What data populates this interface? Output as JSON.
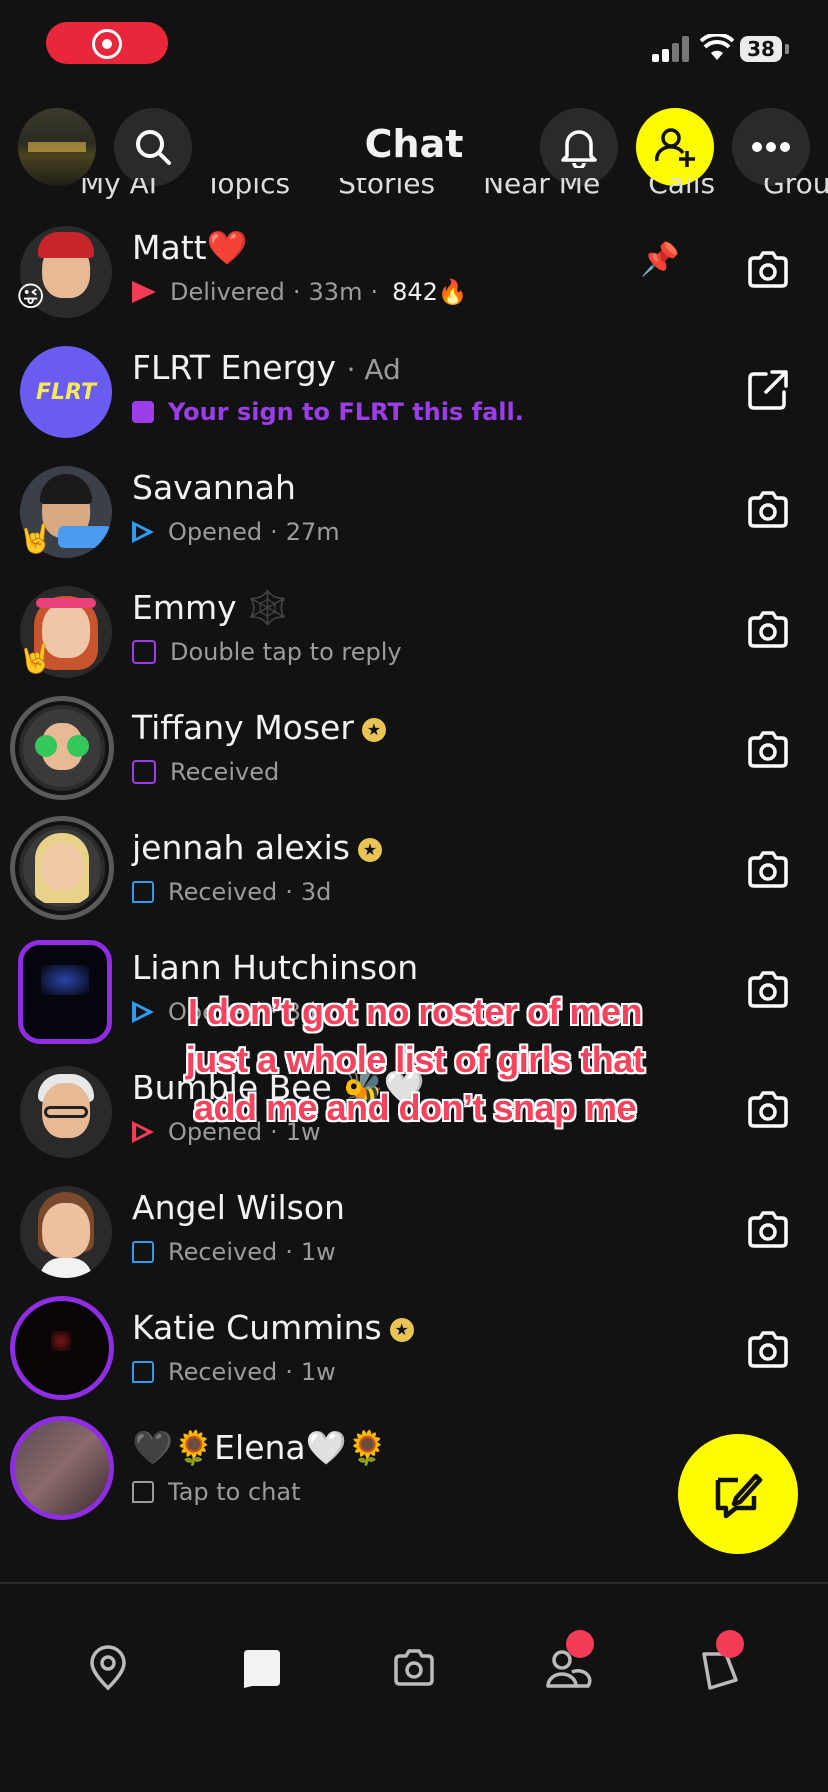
{
  "status_bar": {
    "battery": "38"
  },
  "header": {
    "title": "Chat"
  },
  "tabs": [
    "My AI",
    "Topics",
    "Stories",
    "Near Me",
    "Calls",
    "Groups"
  ],
  "chats": [
    {
      "name": "Matt",
      "name_suffix": "❤️",
      "status": "Delivered",
      "time": "33m",
      "streak": "842🔥",
      "status_icon": "filled-red-arrow",
      "pinned": true,
      "avatar_emoji": "😜",
      "action": "camera"
    },
    {
      "name": "FLRT Energy",
      "name_extra": "· Ad",
      "status": "Your sign to FLRT this fall.",
      "status_icon": "filled-purple-square",
      "action": "external-link"
    },
    {
      "name": "Savannah",
      "status": "Opened",
      "time": "27m",
      "status_icon": "outline-blue-arrow",
      "avatar_emoji": "🤘",
      "action": "camera"
    },
    {
      "name": "Emmy",
      "name_suffix": "🕸️",
      "status": "Double tap to reply",
      "status_icon": "outline-purple-square",
      "avatar_emoji": "🤘",
      "action": "camera"
    },
    {
      "name": "Tiffany Moser",
      "status": "Received",
      "status_icon": "outline-purple-square",
      "badge": "★",
      "action": "camera"
    },
    {
      "name": "jennah alexis",
      "status": "Received",
      "time": "3d",
      "status_icon": "outline-blue-chat",
      "badge": "★",
      "action": "camera"
    },
    {
      "name": "Liann Hutchinson",
      "status": "Opened",
      "time": "3d",
      "status_icon": "outline-blue-arrow",
      "action": "camera"
    },
    {
      "name": "Bumble Bee",
      "name_suffix": "🐝🤍",
      "status": "Opened",
      "time": "1w",
      "status_icon": "outline-red-arrow",
      "action": "camera"
    },
    {
      "name": "Angel Wilson",
      "status": "Received",
      "time": "1w",
      "status_icon": "outline-blue-chat",
      "action": "camera"
    },
    {
      "name": "Katie Cummins",
      "status": "Received",
      "time": "1w",
      "status_icon": "outline-blue-chat",
      "badge": "★",
      "action": "camera"
    },
    {
      "name": "🖤🌻Elena🤍🌻",
      "status": "Tap to chat",
      "status_icon": "outline-gray-chat"
    }
  ],
  "caption": {
    "line1": "I don’t got no roster of men",
    "line2": "just a whole list of girls that",
    "line3": "add me and don’t snap me"
  },
  "colors": {
    "accent_yellow": "#fffc00",
    "snap_red": "#f23c57",
    "chat_blue": "#2e9bf0",
    "purple": "#9b3ee8",
    "background": "#121212"
  },
  "bottom_nav": [
    "map-icon",
    "chat-icon",
    "camera-icon",
    "friends-icon",
    "stories-icon"
  ]
}
